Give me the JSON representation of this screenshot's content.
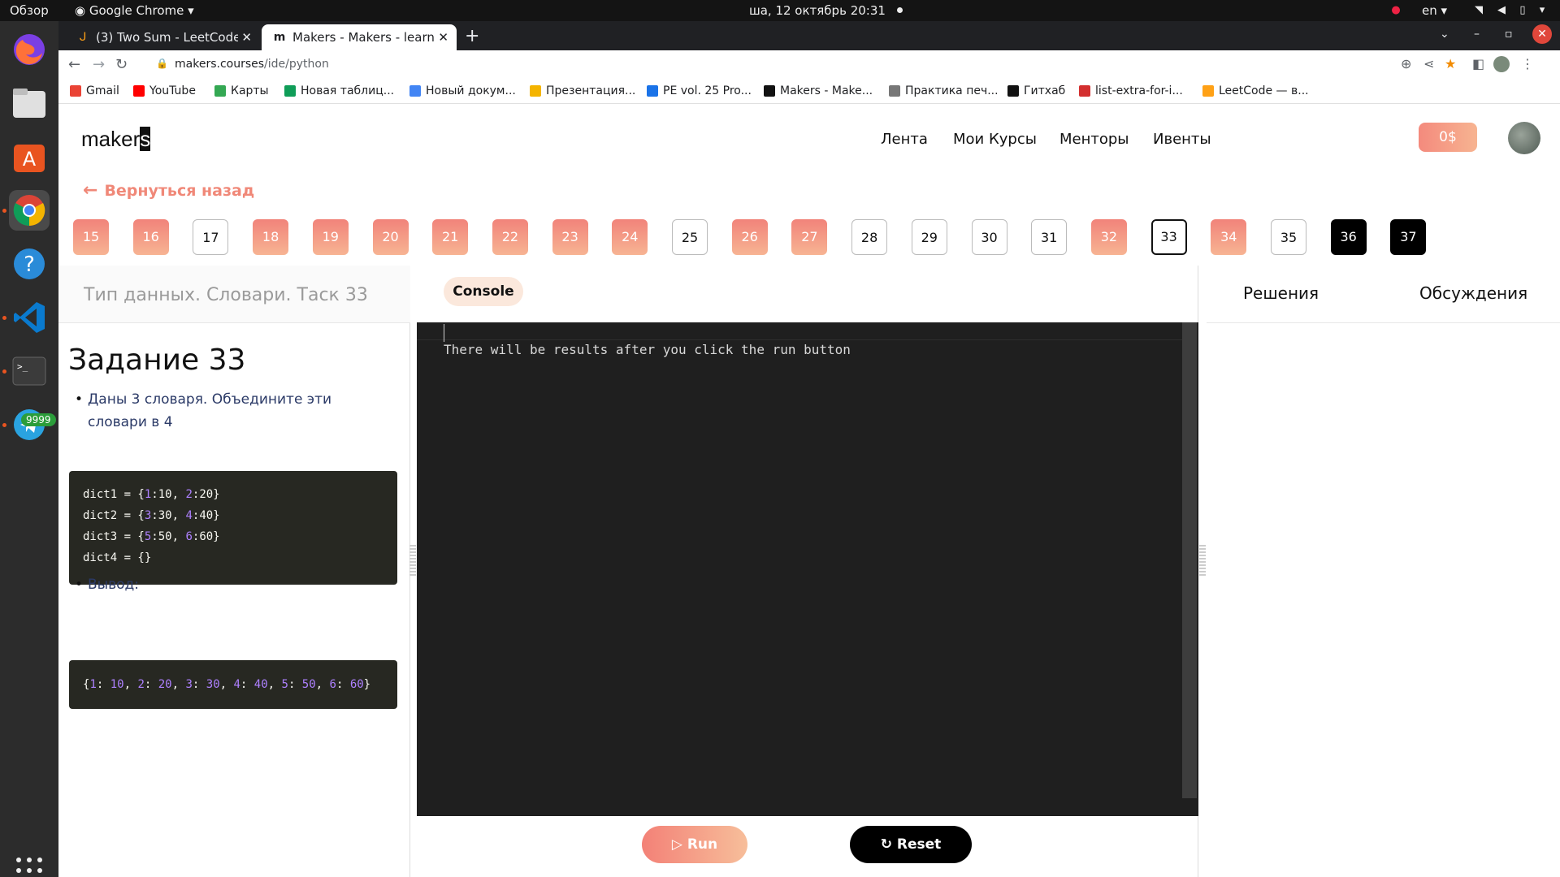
{
  "os": {
    "activities": "Обзор",
    "app_menu": "Google Chrome",
    "datetime": "ша, 12 октябрь  20:31",
    "lang": "en",
    "telegram_badge": "9999"
  },
  "browser": {
    "tabs": [
      {
        "title": "(3) Two Sum - LeetCode",
        "icon": "leetcode-icon"
      },
      {
        "title": "Makers - Makers - learn every",
        "icon": "makers-icon"
      }
    ],
    "url_host": "makers.courses",
    "url_path": "/ide/python",
    "bookmarks": [
      {
        "label": "Gmail",
        "icon": "gmail-icon",
        "color": "#ea4335"
      },
      {
        "label": "YouTube",
        "icon": "youtube-icon",
        "color": "#ff0000"
      },
      {
        "label": "Карты",
        "icon": "maps-icon",
        "color": "#34a853"
      },
      {
        "label": "Новая таблиц...",
        "icon": "sheets-icon",
        "color": "#0f9d58"
      },
      {
        "label": "Новый докум...",
        "icon": "docs-icon",
        "color": "#4285f4"
      },
      {
        "label": "Презентация...",
        "icon": "slides-icon",
        "color": "#f4b400"
      },
      {
        "label": "PE vol. 25 Pro...",
        "icon": "classroom-icon",
        "color": "#1a73e8"
      },
      {
        "label": "Makers - Make...",
        "icon": "makers-icon",
        "color": "#111111"
      },
      {
        "label": "Практика печ...",
        "icon": "typing-icon",
        "color": "#777777"
      },
      {
        "label": "Гитхаб",
        "icon": "github-icon",
        "color": "#111111"
      },
      {
        "label": "list-extra-for-i...",
        "icon": "checker-icon",
        "color": "#d32f2f"
      },
      {
        "label": "LeetCode — в...",
        "icon": "leetcode-icon",
        "color": "#ffa116"
      }
    ]
  },
  "site": {
    "logo": "maker",
    "logo_cursor": "s",
    "nav": [
      "Лента",
      "Мои Курсы",
      "Менторы",
      "Ивенты"
    ],
    "balance": "0$",
    "back_link": "Вернуться назад",
    "accent": "#f48a7d"
  },
  "tasks": [
    {
      "n": "15",
      "state": "done"
    },
    {
      "n": "16",
      "state": "done"
    },
    {
      "n": "17",
      "state": "empty"
    },
    {
      "n": "18",
      "state": "done"
    },
    {
      "n": "19",
      "state": "done"
    },
    {
      "n": "20",
      "state": "done"
    },
    {
      "n": "21",
      "state": "done"
    },
    {
      "n": "22",
      "state": "done"
    },
    {
      "n": "23",
      "state": "done"
    },
    {
      "n": "24",
      "state": "done"
    },
    {
      "n": "25",
      "state": "empty"
    },
    {
      "n": "26",
      "state": "done"
    },
    {
      "n": "27",
      "state": "done"
    },
    {
      "n": "28",
      "state": "empty"
    },
    {
      "n": "29",
      "state": "empty"
    },
    {
      "n": "30",
      "state": "empty"
    },
    {
      "n": "31",
      "state": "empty"
    },
    {
      "n": "32",
      "state": "done"
    },
    {
      "n": "33",
      "state": "current"
    },
    {
      "n": "34",
      "state": "done"
    },
    {
      "n": "35",
      "state": "empty"
    },
    {
      "n": "36",
      "state": "black"
    },
    {
      "n": "37",
      "state": "black"
    }
  ],
  "task": {
    "breadcrumb": "Тип данных. Словари. Таск 33",
    "heading": "Задание 33",
    "description": "Даны 3 словаря. Объедините эти словари в 4",
    "output_label": "Вывод:",
    "code_lines": [
      [
        {
          "t": "dict1 = {"
        },
        {
          "t": "1",
          "n": true
        },
        {
          "t": ":10, "
        },
        {
          "t": "2",
          "n": true
        },
        {
          "t": ":20}"
        }
      ],
      [
        {
          "t": "dict2 = {"
        },
        {
          "t": "3",
          "n": true
        },
        {
          "t": ":30, "
        },
        {
          "t": "4",
          "n": true
        },
        {
          "t": ":40}"
        }
      ],
      [
        {
          "t": "dict3 = {"
        },
        {
          "t": "5",
          "n": true
        },
        {
          "t": ":50, "
        },
        {
          "t": "6",
          "n": true
        },
        {
          "t": ":60}"
        }
      ],
      [
        {
          "t": "dict4 = {}"
        }
      ]
    ],
    "output_line": [
      {
        "t": "{"
      },
      {
        "t": "1",
        "n": true
      },
      {
        "t": ": "
      },
      {
        "t": "10",
        "n": true
      },
      {
        "t": ", "
      },
      {
        "t": "2",
        "n": true
      },
      {
        "t": ": "
      },
      {
        "t": "20",
        "n": true
      },
      {
        "t": ", "
      },
      {
        "t": "3",
        "n": true
      },
      {
        "t": ": "
      },
      {
        "t": "30",
        "n": true
      },
      {
        "t": ", "
      },
      {
        "t": "4",
        "n": true
      },
      {
        "t": ": "
      },
      {
        "t": "40",
        "n": true
      },
      {
        "t": ", "
      },
      {
        "t": "5",
        "n": true
      },
      {
        "t": ": "
      },
      {
        "t": "50",
        "n": true
      },
      {
        "t": ", "
      },
      {
        "t": "6",
        "n": true
      },
      {
        "t": ": "
      },
      {
        "t": "60",
        "n": true
      },
      {
        "t": "}"
      }
    ]
  },
  "console": {
    "tab": "Console",
    "placeholder": "There will be results after you click the run button",
    "run": "Run",
    "reset": "Reset"
  },
  "right": {
    "tabs": [
      "Решения",
      "Обсуждения"
    ]
  }
}
